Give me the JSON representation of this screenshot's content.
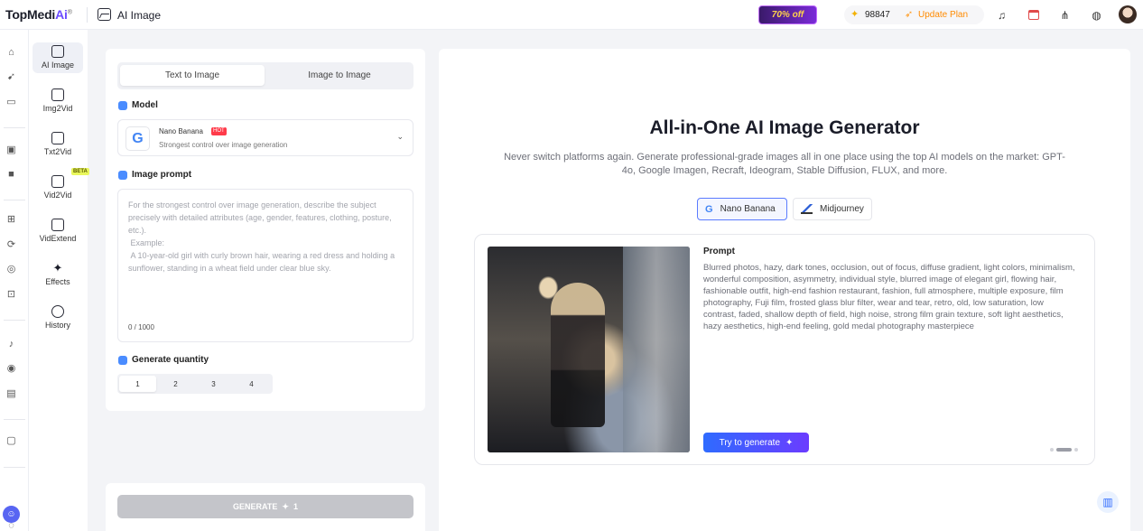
{
  "app": {
    "logo_main": "TopMedi",
    "logo_ai": "Ai",
    "logo_reg": "®",
    "page_title": "AI Image"
  },
  "header": {
    "promo_label": "70% off",
    "credits": "98847",
    "update_label": "Update Plan",
    "icons": [
      "bell-icon",
      "calendar-icon",
      "network-icon",
      "globe-icon",
      "avatar"
    ]
  },
  "rail": {
    "icons": [
      "home-icon",
      "compass-icon",
      "folder-icon",
      "video-edit-icon",
      "camera-icon",
      "file-add-icon",
      "file-refresh-icon",
      "target-icon",
      "badge-icon",
      "music-icon",
      "spiral-icon",
      "film-icon",
      "ai-box-icon",
      "discord-icon",
      "chat-icon"
    ]
  },
  "tools": [
    {
      "label": "AI Image"
    },
    {
      "label": "Img2Vid"
    },
    {
      "label": "Txt2Vid"
    },
    {
      "label": "Vid2Vid",
      "badge": "BETA"
    },
    {
      "label": "VidExtend"
    },
    {
      "label": "Effects"
    },
    {
      "label": "History"
    }
  ],
  "panel": {
    "tabs": [
      "Text to Image",
      "Image to Image"
    ],
    "model_heading": "Model",
    "model": {
      "name": "Nano Banana",
      "tag": "HOT",
      "description": "Strongest control over image generation"
    },
    "prompt_heading": "Image prompt",
    "prompt_placeholder": "For the strongest control over image generation, describe the subject precisely with detailed attributes (age, gender, features, clothing, posture, etc.).\n Example:\n A 10-year-old girl with curly brown hair, wearing a red dress and holding a sunflower, standing in a wheat field under clear blue sky.",
    "counter": "0 / 1000",
    "quantity_heading": "Generate quantity",
    "quantities": [
      "1",
      "2",
      "3",
      "4"
    ],
    "selected_quantity": "1",
    "generate_label": "GENERATE",
    "generate_cost": "1"
  },
  "main": {
    "title": "All-in-One AI Image Generator",
    "subtitle": "Never switch platforms again. Generate professional-grade images all in one place using the top AI models on the market: GPT-4o, Google Imagen, Recraft, Ideogram, Stable Diffusion, FLUX, and more.",
    "model_tabs": [
      "Nano Banana",
      "Midjourney"
    ],
    "card": {
      "prompt_label": "Prompt",
      "prompt_text": "Blurred photos, hazy, dark tones, occlusion, out of focus, diffuse gradient, light colors, minimalism, wonderful composition, asymmetry, individual style, blurred image of elegant girl, flowing hair, fashionable outfit, high-end fashion restaurant, fashion, full atmosphere, multiple exposure, film photography, Fuji film, frosted glass blur filter, wear and tear, retro, old, low saturation, low contrast, faded, shallow depth of field, high noise, strong film grain texture, soft light aesthetics, hazy aesthetics, high-end feeling, gold medal photography masterpiece",
      "try_label": "Try to generate",
      "carousel_index": 2,
      "carousel_total": 3
    }
  }
}
